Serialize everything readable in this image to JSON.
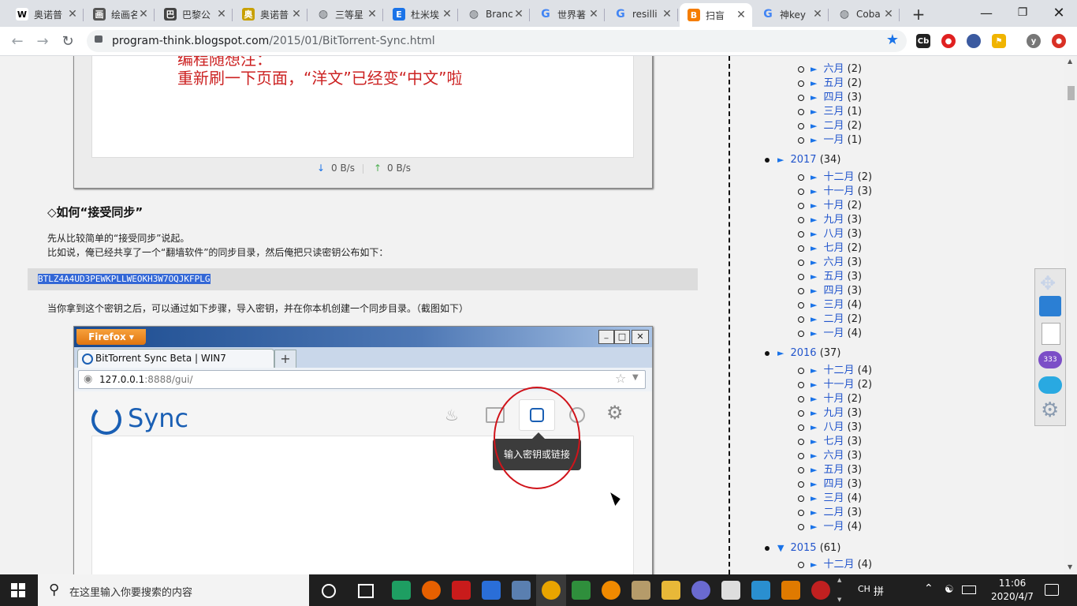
{
  "tabs": [
    {
      "title": "奥诺普",
      "icon": "wikipedia-icon",
      "color": "#ffffff",
      "glyph": "W"
    },
    {
      "title": "绘画名",
      "icon": "site-icon",
      "color": "#555555",
      "glyph": "画"
    },
    {
      "title": "巴黎公",
      "icon": "site-icon",
      "color": "#444444",
      "glyph": "巴"
    },
    {
      "title": "奥诺普",
      "icon": "site-icon",
      "color": "#c8a000",
      "glyph": "奥"
    },
    {
      "title": "三等星",
      "icon": "globe-icon",
      "color": "#5f6368",
      "glyph": "◍"
    },
    {
      "title": "杜米埃",
      "icon": "e-icon",
      "color": "#1a73e8",
      "glyph": "E"
    },
    {
      "title": "Branc",
      "icon": "globe-icon",
      "color": "#5f6368",
      "glyph": "◍"
    },
    {
      "title": "世界著",
      "icon": "google-icon",
      "color": "#4285f4",
      "glyph": "G"
    },
    {
      "title": "resilli",
      "icon": "google-icon",
      "color": "#4285f4",
      "glyph": "G"
    },
    {
      "title": "扫盲",
      "icon": "blogger-icon",
      "color": "#f57d00",
      "glyph": "B",
      "active": true
    },
    {
      "title": "神key",
      "icon": "google-icon",
      "color": "#4285f4",
      "glyph": "G"
    },
    {
      "title": "Coba",
      "icon": "globe-icon",
      "color": "#5f6368",
      "glyph": "◍"
    }
  ],
  "new_tab_label": "+",
  "address": {
    "host": "program-think.blogspot.com",
    "path": "/2015/01/BitTorrent-Sync.html"
  },
  "extensions": [
    "Cb",
    "●",
    "2",
    "⚑",
    "y",
    "⬤"
  ],
  "article": {
    "note_label": "编程随想注：",
    "note_text": "重新刷一下页面，“洋文”已经变“中文”啦",
    "down_speed": "0 B/s",
    "up_speed": "0 B/s",
    "heading": "◇如何“接受同步”",
    "para1": "先从比较简单的“接受同步”说起。",
    "para2": "比如说，俺已经共享了一个“翻墙软件”的同步目录，然后俺把只读密钥公布如下：",
    "key": "BTLZ4A4UD3PEWKPLLWEOKH3W7OQJKFPLG",
    "para3": "当你拿到这个密钥之后，可以通过如下步骤，导入密钥，并在你本机创建一个同步目录。（截图如下）"
  },
  "screenshot2": {
    "firefox_label": "Firefox ▾",
    "tab_title": "BitTorrent Sync Beta | WIN7",
    "url_host": "127.0.0.1",
    "url_rest": ":8888/gui/",
    "app_name": "Sync",
    "tooltip": "输入密钥或链接",
    "win_min": "_",
    "win_max": "□",
    "win_close": "✕",
    "tab_plus": "+"
  },
  "archive": {
    "top_months": [
      {
        "name": "六月",
        "count": "(2)"
      },
      {
        "name": "五月",
        "count": "(2)"
      },
      {
        "name": "四月",
        "count": "(3)"
      },
      {
        "name": "三月",
        "count": "(1)"
      },
      {
        "name": "二月",
        "count": "(2)"
      },
      {
        "name": "一月",
        "count": "(1)"
      }
    ],
    "year2017": {
      "year": "2017",
      "count": "(34)",
      "months": [
        {
          "name": "十二月",
          "count": "(2)"
        },
        {
          "name": "十一月",
          "count": "(3)"
        },
        {
          "name": "十月",
          "count": "(2)"
        },
        {
          "name": "九月",
          "count": "(3)"
        },
        {
          "name": "八月",
          "count": "(3)"
        },
        {
          "name": "七月",
          "count": "(2)"
        },
        {
          "name": "六月",
          "count": "(3)"
        },
        {
          "name": "五月",
          "count": "(3)"
        },
        {
          "name": "四月",
          "count": "(3)"
        },
        {
          "name": "三月",
          "count": "(4)"
        },
        {
          "name": "二月",
          "count": "(2)"
        },
        {
          "name": "一月",
          "count": "(4)"
        }
      ]
    },
    "year2016": {
      "year": "2016",
      "count": "(37)",
      "months": [
        {
          "name": "十二月",
          "count": "(4)"
        },
        {
          "name": "十一月",
          "count": "(2)"
        },
        {
          "name": "十月",
          "count": "(2)"
        },
        {
          "name": "九月",
          "count": "(3)"
        },
        {
          "name": "八月",
          "count": "(3)"
        },
        {
          "name": "七月",
          "count": "(3)"
        },
        {
          "name": "六月",
          "count": "(3)"
        },
        {
          "name": "五月",
          "count": "(3)"
        },
        {
          "name": "四月",
          "count": "(3)"
        },
        {
          "name": "三月",
          "count": "(4)"
        },
        {
          "name": "二月",
          "count": "(3)"
        },
        {
          "name": "一月",
          "count": "(4)"
        }
      ]
    },
    "year2015": {
      "year": "2015",
      "count": "(61)",
      "first_month": {
        "name": "十二月",
        "count": "(4)"
      }
    }
  },
  "float_toolbar_badge": "333",
  "taskbar": {
    "search_placeholder": "在这里输入你要搜索的内容",
    "ime": "CH",
    "ime2": "拼",
    "time": "11:06",
    "date": "2020/4/7"
  },
  "colors": {
    "accent": "#1a73e8",
    "note_red": "#cc2222",
    "highlight": "#3367d6",
    "annotation_circle": "#d0141b"
  }
}
